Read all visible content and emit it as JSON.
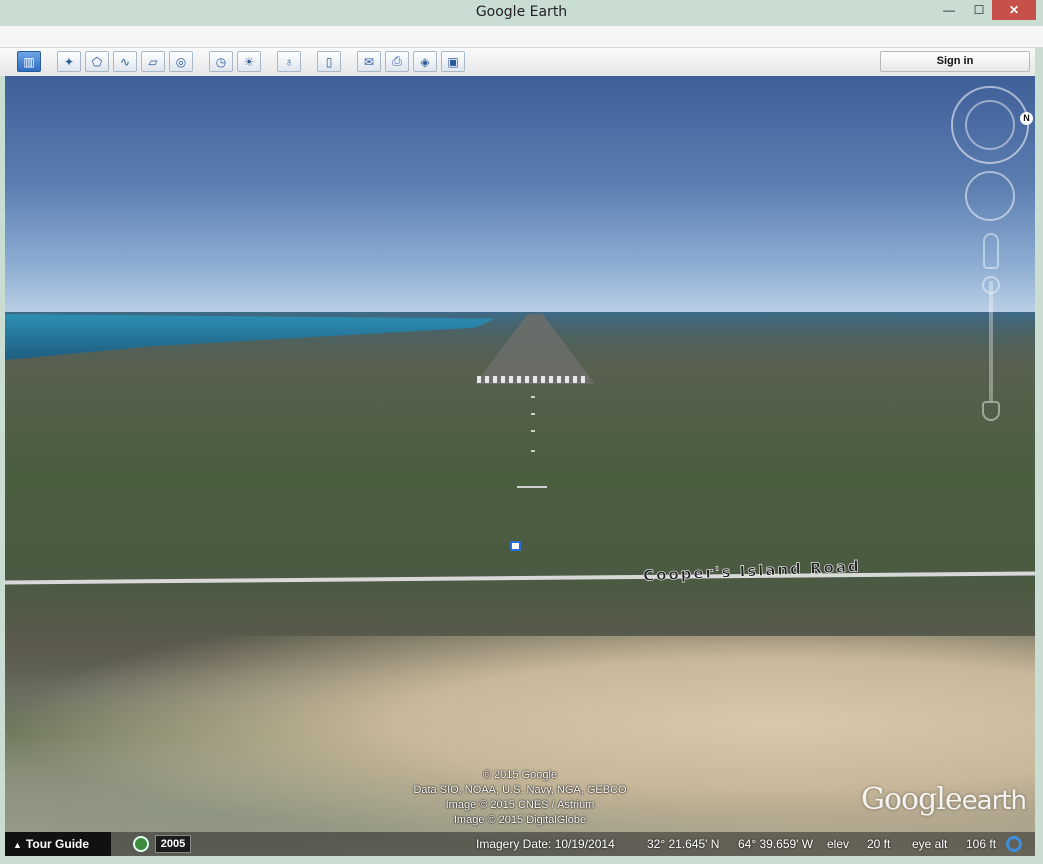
{
  "window": {
    "title": "Google Earth",
    "min_glyph": "—",
    "max_glyph": "☐",
    "close_glyph": "✕"
  },
  "toolbar": {
    "buttons": [
      {
        "name": "sidebar-toggle-button",
        "glyph": "▥"
      },
      {
        "name": "add-placemark-button",
        "glyph": "✦"
      },
      {
        "name": "add-polygon-button",
        "glyph": "⬠"
      },
      {
        "name": "add-path-button",
        "glyph": "∿"
      },
      {
        "name": "add-image-overlay-button",
        "glyph": "▱"
      },
      {
        "name": "record-tour-button",
        "glyph": "◎"
      },
      {
        "name": "historical-imagery-button",
        "glyph": "◷"
      },
      {
        "name": "sunlight-button",
        "glyph": "☀"
      },
      {
        "name": "planets-button",
        "glyph": "♁"
      },
      {
        "name": "ruler-button",
        "glyph": "▯"
      },
      {
        "name": "email-button",
        "glyph": "✉"
      },
      {
        "name": "print-button",
        "glyph": "⎙"
      },
      {
        "name": "view-in-maps-button",
        "glyph": "◈"
      },
      {
        "name": "save-image-button",
        "glyph": "▣"
      }
    ],
    "sign_in": "Sign in"
  },
  "map": {
    "road_label": "Cooper's Island Road",
    "compass_north": "N",
    "credits": [
      "© 2015 Google",
      "Data SIO, NOAA, U.S. Navy, NGA, GEBCO",
      "Image © 2015 CNES / Astrium",
      "Image © 2015 DigitalGlobe"
    ],
    "logo_google": "Google",
    "logo_earth": "earth"
  },
  "status": {
    "tour_guide": "Tour Guide",
    "tour_glyph": "▲",
    "year": "2005",
    "imagery_date": "Imagery Date: 10/19/2014",
    "lat": "32° 21.645' N",
    "lon": "64° 39.659' W",
    "elev_label": "elev",
    "elev_value": "20 ft",
    "eye_alt_label": "eye alt",
    "eye_alt_value": "106 ft"
  }
}
